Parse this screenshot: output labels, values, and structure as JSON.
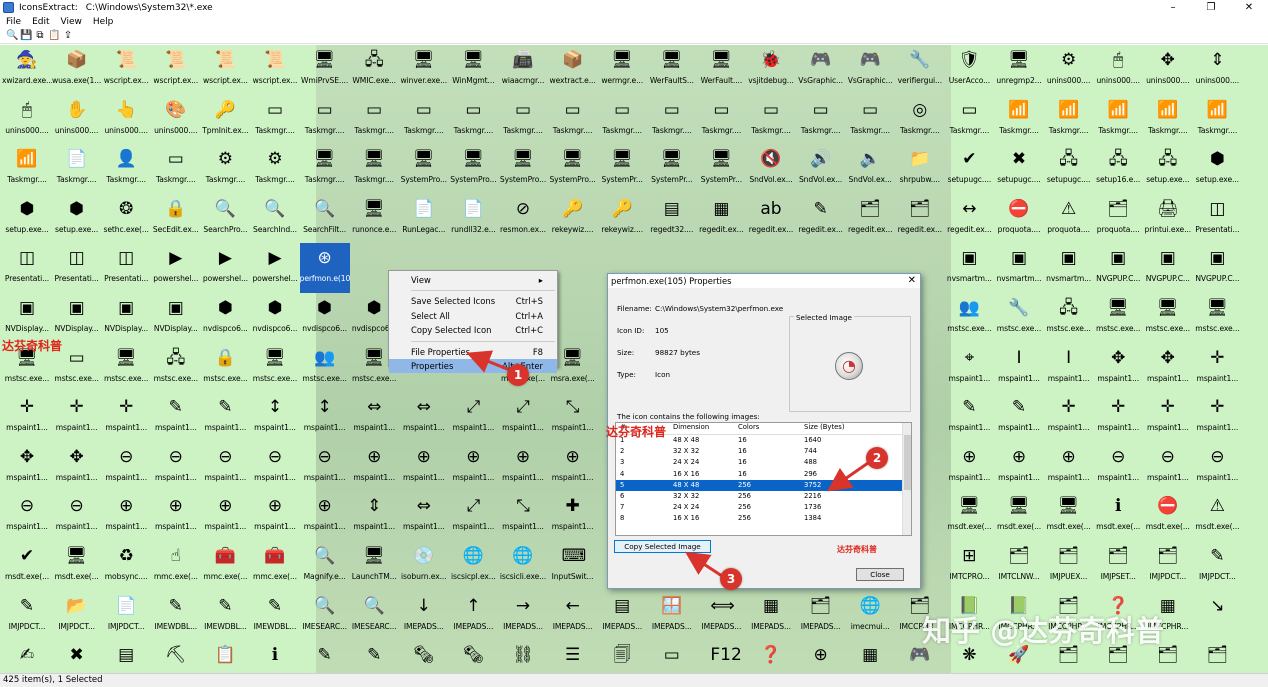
{
  "window": {
    "app_title": "IconsExtract:",
    "path": "C:\\Windows\\System32\\*.exe",
    "minimize_glyph": "–",
    "maximize_glyph": "❐",
    "close_glyph": "✕"
  },
  "menu": [
    "File",
    "Edit",
    "View",
    "Help"
  ],
  "toolbar_icons": [
    "search-icon",
    "save-icon",
    "copy-icon",
    "properties-icon",
    "exit-icon"
  ],
  "toolbar_glyphs": [
    "🔍",
    "💾",
    "⧉",
    "📋",
    "⇪"
  ],
  "grid": {
    "rows": [
      [
        "xwizard.exe...",
        "wusa.exe(1...",
        "wscript.ex...",
        "wscript.ex...",
        "wscript.ex...",
        "wscript.ex...",
        "WmiPrvSE....",
        "WMIC.exe...",
        "winver.exe...",
        "WinMgmt...",
        "wiaacmgr...",
        "wextract.e...",
        "wermgr.e...",
        "WerFaultS...",
        "WerFault....",
        "vsjitdebug...",
        "VsGraphic...",
        "VsGraphic...",
        "verifiergui...",
        "UserAcco...",
        "unregmp2...",
        "unins000....",
        "unins000....",
        "unins000....",
        "unins000...."
      ],
      [
        "unins000....",
        "unins000....",
        "unins000....",
        "unins000....",
        "TpmInit.ex...",
        "Taskmgr....",
        "Taskmgr....",
        "Taskmgr....",
        "Taskmgr....",
        "Taskmgr....",
        "Taskmgr....",
        "Taskmgr....",
        "Taskmgr....",
        "Taskmgr....",
        "Taskmgr....",
        "Taskmgr....",
        "Taskmgr....",
        "Taskmgr....",
        "Taskmgr....",
        "Taskmgr....",
        "Taskmgr....",
        "Taskmgr....",
        "Taskmgr....",
        "Taskmgr....",
        "Taskmgr...."
      ],
      [
        "Taskmgr....",
        "Taskmgr....",
        "Taskmgr....",
        "Taskmgr....",
        "Taskmgr....",
        "Taskmgr....",
        "Taskmgr....",
        "Taskmgr....",
        "SystemPro...",
        "SystemPro...",
        "SystemPro...",
        "SystemPro...",
        "SystemPr...",
        "SystemPr...",
        "SystemPr...",
        "SndVol.ex...",
        "SndVol.ex...",
        "SndVol.ex...",
        "shrpubw....",
        "setupugc....",
        "setupugc....",
        "setupugc....",
        "setup16.e...",
        "setup.exe...",
        "setup.exe..."
      ],
      [
        "setup.exe...",
        "setup.exe...",
        "sethc.exe(...",
        "SecEdit.ex...",
        "SearchPro...",
        "SearchInd...",
        "SearchFilt...",
        "runonce.e...",
        "RunLegac...",
        "rundll32.e...",
        "resmon.ex...",
        "rekeywiz....",
        "rekeywiz....",
        "regedt32....",
        "regedit.ex...",
        "regedit.ex...",
        "regedit.ex...",
        "regedit.ex...",
        "regedit.ex...",
        "regedit.ex...",
        "proquota....",
        "proquota....",
        "proquota....",
        "printui.exe...",
        "Presentati..."
      ],
      [
        "Presentati...",
        "Presentati...",
        "Presentati...",
        "powershel...",
        "powershel...",
        "powershel...",
        "perfmon.e(105)",
        "",
        "",
        "",
        "",
        "",
        "",
        "",
        "",
        "",
        "",
        "",
        "",
        "nvsmartm...",
        "nvsmartm...",
        "nvsmartm...",
        "NVGPUP.C...",
        "NVGPUP.C...",
        "NVGPUP.C..."
      ],
      [
        "NVDisplay...",
        "NVDisplay...",
        "NVDisplay...",
        "NVDisplay...",
        "nvdispco6...",
        "nvdispco6...",
        "nvdispco6...",
        "nvdispco6...",
        "",
        "",
        "",
        "",
        "",
        "",
        "",
        "",
        "",
        "",
        "",
        "mstsc.exe...",
        "mstsc.exe...",
        "mstsc.exe...",
        "mstsc.exe...",
        "mstsc.exe...",
        "mstsc.exe..."
      ],
      [
        "mstsc.exe...",
        "mstsc.exe...",
        "mstsc.exe...",
        "mstsc.exe...",
        "mstsc.exe...",
        "mstsc.exe...",
        "mstsc.exe...",
        "mstsc.exe...",
        "",
        "",
        "msra.exe(...",
        "msra.exe(...",
        "",
        "",
        "",
        "",
        "",
        "",
        "",
        "mspaint1...",
        "mspaint1...",
        "mspaint1...",
        "mspaint1...",
        "mspaint1...",
        "mspaint1..."
      ],
      [
        "mspaint1...",
        "mspaint1...",
        "mspaint1...",
        "mspaint1...",
        "mspaint1...",
        "mspaint1...",
        "mspaint1...",
        "mspaint1...",
        "mspaint1...",
        "mspaint1...",
        "mspaint1...",
        "mspaint1...",
        "",
        "",
        "",
        "",
        "",
        "",
        "",
        "mspaint1...",
        "mspaint1...",
        "mspaint1...",
        "mspaint1...",
        "mspaint1...",
        "mspaint1..."
      ],
      [
        "mspaint1...",
        "mspaint1...",
        "mspaint1...",
        "mspaint1...",
        "mspaint1...",
        "mspaint1...",
        "mspaint1...",
        "mspaint1...",
        "mspaint1...",
        "mspaint1...",
        "mspaint1...",
        "mspaint1...",
        "",
        "",
        "",
        "",
        "",
        "",
        "",
        "mspaint1...",
        "mspaint1...",
        "mspaint1...",
        "mspaint1...",
        "mspaint1...",
        "mspaint1..."
      ],
      [
        "mspaint1...",
        "mspaint1...",
        "mspaint1...",
        "mspaint1...",
        "mspaint1...",
        "mspaint1...",
        "mspaint1...",
        "mspaint1...",
        "mspaint1...",
        "mspaint1...",
        "mspaint1...",
        "mspaint1...",
        "",
        "",
        "",
        "",
        "",
        "",
        "",
        "msdt.exe(...",
        "msdt.exe(...",
        "msdt.exe(...",
        "msdt.exe(...",
        "msdt.exe(...",
        "msdt.exe(..."
      ],
      [
        "msdt.exe(...",
        "msdt.exe(...",
        "mobsync....",
        "mmc.exe(...",
        "mmc.exe(...",
        "mmc.exe(...",
        "Magnify.e...",
        "LaunchTM...",
        "isoburn.ex...",
        "iscsicpl.ex...",
        "iscsicli.exe...",
        "InputSwit...",
        "",
        "",
        "",
        "",
        "",
        "",
        "",
        "IMTCPRO...",
        "IMTCLNW...",
        "IMJPUEX...",
        "IMJPSET...",
        "IMJPDCT...",
        "IMJPDCT..."
      ],
      [
        "IMJPDCT...",
        "IMJPDCT...",
        "IMJPDCT...",
        "IMEWDBL...",
        "IMEWDBL...",
        "IMEWDBL...",
        "IMESEARC...",
        "IMESEARC...",
        "IMEPADS...",
        "IMEPADS...",
        "IMEPADS...",
        "IMEPADS...",
        "IMEPADS...",
        "IMEPADS...",
        "IMEPADS...",
        "IMEPADS...",
        "IMEPADS...",
        "imecmui...",
        "IMCCPHR...",
        "IMCCPHR...",
        "IMCCPHR...",
        "IMCCPHR...",
        "IMCCPHR...",
        "IMCCPHR...",
        ""
      ],
      [
        "",
        "",
        "",
        "",
        "",
        "",
        "",
        "",
        "",
        "",
        "",
        "",
        "",
        "",
        "",
        "",
        "",
        "",
        "",
        "",
        "",
        "",
        "",
        "",
        ""
      ]
    ],
    "glyph_rows": [
      [
        "🧙",
        "📦",
        "📜",
        "📜",
        "📜",
        "📜",
        "🖥",
        "🖧",
        "🖥",
        "🖥",
        "📠",
        "📦",
        "🖥",
        "🖥",
        "🖥",
        "🐞",
        "🎮",
        "🎮",
        "🔧",
        "🛡",
        "🖥",
        "⚙",
        "🖱",
        "✥",
        "⇕"
      ],
      [
        "🖱",
        "✋",
        "👆",
        "🎨",
        "🔑",
        "▭",
        "▭",
        "▭",
        "▭",
        "▭",
        "▭",
        "▭",
        "▭",
        "▭",
        "▭",
        "▭",
        "▭",
        "▭",
        "◎",
        "▭",
        "📶",
        "📶",
        "📶",
        "📶",
        "📶"
      ],
      [
        "📶",
        "📄",
        "👤",
        "▭",
        "⚙",
        "⚙",
        "🖥",
        "🖥",
        "🖥",
        "🖥",
        "🖥",
        "🖥",
        "🖥",
        "🖥",
        "🖥",
        "🔇",
        "🔊",
        "🔈",
        "📁",
        "✔",
        "✖",
        "🖧",
        "🖧",
        "🖧",
        "⬢"
      ],
      [
        "⬢",
        "⬢",
        "❂",
        "🔒",
        "🔍",
        "🔍",
        "🔍",
        "🖥",
        "📄",
        "📄",
        "⊘",
        "🔑",
        "🔑",
        "▤",
        "▦",
        "ab",
        "✎",
        "🗂",
        "🗂",
        "↔",
        "⛔",
        "⚠",
        "🗂",
        "🖨",
        "◫"
      ],
      [
        "◫",
        "◫",
        "◫",
        "▶",
        "▶",
        "▶",
        "⊛",
        "",
        "",
        "",
        "",
        "",
        "",
        "",
        "",
        "",
        "",
        "",
        "",
        "▣",
        "▣",
        "▣",
        "▣",
        "▣",
        "▣"
      ],
      [
        "▣",
        "▣",
        "▣",
        "▣",
        "⬢",
        "⬢",
        "⬢",
        "⬢",
        "",
        "",
        "",
        "",
        "",
        "",
        "",
        "",
        "",
        "",
        "",
        "👥",
        "🔧",
        "🖧",
        "🖥",
        "🖥",
        "🖥"
      ],
      [
        "🖥",
        "▭",
        "🖥",
        "🖧",
        "🔒",
        "🖥",
        "👥",
        "🖥",
        "",
        "",
        "🖥",
        "🖥",
        "",
        "",
        "",
        "",
        "",
        "",
        "",
        "⌖",
        "I",
        "I",
        "✥",
        "✥",
        "✛"
      ],
      [
        "✛",
        "✛",
        "✛",
        "✎",
        "✎",
        "↕",
        "↕",
        "⇔",
        "⇔",
        "⤢",
        "⤢",
        "⤡",
        "",
        "",
        "",
        "",
        "",
        "",
        "",
        "✎",
        "✎",
        "✛",
        "✛",
        "✛",
        "✛"
      ],
      [
        "✥",
        "✥",
        "⊖",
        "⊖",
        "⊖",
        "⊖",
        "⊖",
        "⊕",
        "⊕",
        "⊕",
        "⊕",
        "⊕",
        "",
        "",
        "",
        "",
        "",
        "",
        "",
        "⊕",
        "⊕",
        "⊕",
        "⊖",
        "⊖",
        "⊖"
      ],
      [
        "⊖",
        "⊖",
        "⊕",
        "⊕",
        "⊕",
        "⊕",
        "⊕",
        "⇕",
        "⇔",
        "⤢",
        "⤡",
        "✚",
        "",
        "",
        "",
        "",
        "",
        "",
        "",
        "🖥",
        "🖥",
        "🖥",
        "ℹ",
        "⛔",
        "⚠"
      ],
      [
        "✔",
        "🖥",
        "♻",
        "☝",
        "🧰",
        "🧰",
        "🔍",
        "🖥",
        "💿",
        "🌐",
        "🌐",
        "⌨",
        "",
        "",
        "",
        "",
        "",
        "",
        "",
        "⊞",
        "🗂",
        "🗂",
        "🗂",
        "🗂",
        "✎"
      ],
      [
        "✎",
        "📂",
        "📄",
        "✎",
        "✎",
        "✎",
        "🔍",
        "🔍",
        "↓",
        "↑",
        "→",
        "←",
        "▤",
        "🪟",
        "⟺",
        "▦",
        "🗂",
        "🌐",
        "🗂",
        "📗",
        "📗",
        "🗂",
        "❓",
        "▦",
        "↘"
      ],
      [
        "✍",
        "✖",
        "▤",
        "⛏",
        "📋",
        "ℹ",
        "✎",
        "✎",
        "🗞",
        "🗞",
        "⛓",
        "☰",
        "🗐",
        "▭",
        "F12",
        "❓",
        "⊕",
        "▦",
        "🎮",
        "❋",
        "🚀",
        "🗂",
        "🗂",
        "🗂",
        "🗂"
      ]
    ],
    "selected": "perfmon.e(105)"
  },
  "context_menu": {
    "items": [
      {
        "label": "View",
        "shortcut": "▸"
      },
      {
        "label": "Save Selected Icons",
        "shortcut": "Ctrl+S"
      },
      {
        "label": "Select All",
        "shortcut": "Ctrl+A"
      },
      {
        "label": "Copy Selected Icon",
        "shortcut": "Ctrl+C"
      },
      {
        "label": "File Properties",
        "shortcut": "F8"
      },
      {
        "label": "Properties",
        "shortcut": "Alt+Enter"
      }
    ]
  },
  "properties_dialog": {
    "title": "perfmon.exe(105) Properties",
    "close_glyph": "✕",
    "filename_label": "Filename:",
    "filename_value": "C:\\Windows\\System32\\perfmon.exe",
    "icon_id_label": "Icon ID:",
    "icon_id_value": "105",
    "size_label": "Size:",
    "size_value": "98827 bytes",
    "type_label": "Type:",
    "type_value": "Icon",
    "selected_image_label": "Selected Image",
    "contains_label": "The icon contains the following images:",
    "columns": [
      "#",
      "Dimension",
      "Colors",
      "Size (Bytes)"
    ],
    "rows": [
      [
        "1",
        "48 X 48",
        "16",
        "1640"
      ],
      [
        "2",
        "32 X 32",
        "16",
        "744"
      ],
      [
        "3",
        "24 X 24",
        "16",
        "488"
      ],
      [
        "4",
        "16 X 16",
        "16",
        "296"
      ],
      [
        "5",
        "48 X 48",
        "256",
        "3752"
      ],
      [
        "6",
        "32 X 32",
        "256",
        "2216"
      ],
      [
        "7",
        "24 X 24",
        "256",
        "1736"
      ],
      [
        "8",
        "16 X 16",
        "256",
        "1384"
      ]
    ],
    "selected_row_index": 4,
    "copy_button": "Copy Selected Image",
    "close_button": "Close"
  },
  "annotations": {
    "marker_1": "1",
    "marker_2": "2",
    "marker_3": "3",
    "accent": "#d9342b"
  },
  "watermarks": {
    "left": "达芬奇科普",
    "center": "达芬奇科普",
    "dialog": "达芬奇科普",
    "zhihu": "知乎 @达芬奇科普"
  },
  "status": "425 item(s), 1 Selected"
}
